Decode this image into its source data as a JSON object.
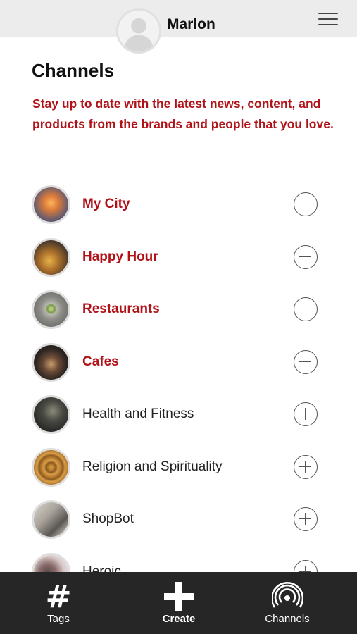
{
  "header": {
    "user_name": "Marlon",
    "avatar_icon": "user-silhouette-icon",
    "menu_icon": "hamburger-menu-icon"
  },
  "page": {
    "title": "Channels",
    "description": "Stay up to date with the latest news, content, and products from the brands and people that you love."
  },
  "channels": [
    {
      "name": "My City",
      "subscribed": true,
      "action_icon": "minus-circle-icon"
    },
    {
      "name": "Happy Hour",
      "subscribed": true,
      "action_icon": "minus-circle-icon"
    },
    {
      "name": "Restaurants",
      "subscribed": true,
      "action_icon": "minus-circle-icon"
    },
    {
      "name": "Cafes",
      "subscribed": true,
      "action_icon": "minus-circle-icon"
    },
    {
      "name": "Health and Fitness",
      "subscribed": false,
      "action_icon": "plus-circle-icon"
    },
    {
      "name": "Religion and Spirituality",
      "subscribed": false,
      "action_icon": "plus-circle-icon"
    },
    {
      "name": "ShopBot",
      "subscribed": false,
      "action_icon": "plus-circle-icon"
    },
    {
      "name": "Heroic",
      "subscribed": false,
      "action_icon": "plus-circle-icon"
    }
  ],
  "tabbar": {
    "tags": {
      "label": "Tags",
      "icon": "hash-icon"
    },
    "create": {
      "label": "Create",
      "icon": "plus-icon"
    },
    "channels": {
      "label": "Channels",
      "icon": "broadcast-icon"
    }
  },
  "colors": {
    "accent": "#b01218",
    "header_bg": "#ececec",
    "tabbar_bg": "#262626"
  }
}
